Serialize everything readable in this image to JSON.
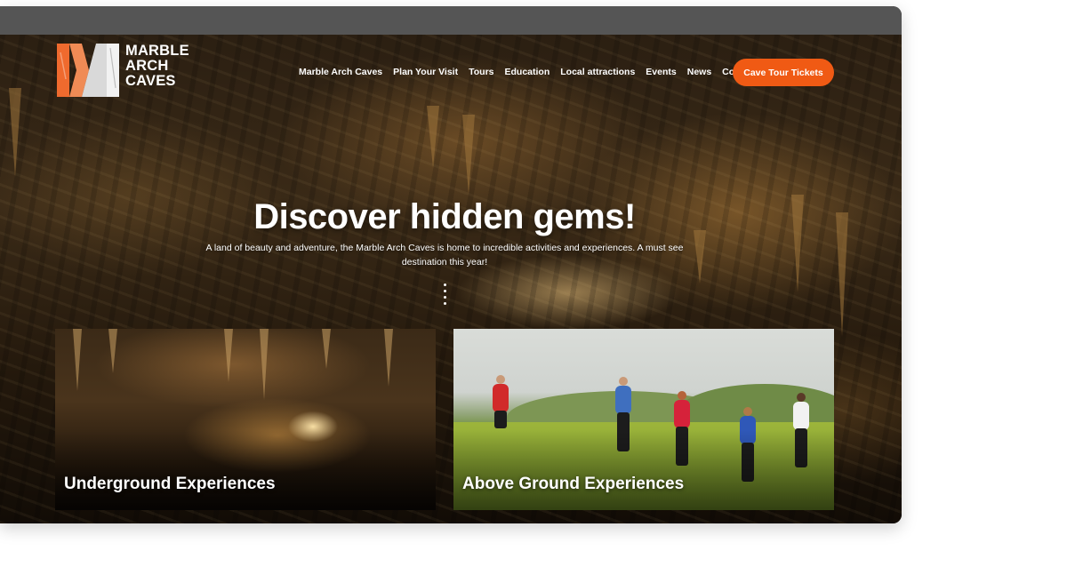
{
  "brand": {
    "name_line1": "MARBLE",
    "name_line2": "ARCH",
    "name_line3": "CAVES",
    "accent_color": "#f05a14"
  },
  "nav": {
    "items": [
      {
        "label": "Marble Arch Caves"
      },
      {
        "label": "Plan Your Visit"
      },
      {
        "label": "Tours"
      },
      {
        "label": "Education"
      },
      {
        "label": "Local attractions"
      },
      {
        "label": "Events"
      },
      {
        "label": "News"
      },
      {
        "label": "Contact"
      }
    ],
    "cta_label": "Cave Tour Tickets"
  },
  "hero": {
    "title": "Discover hidden gems!",
    "subtitle": "A land of beauty and adventure, the Marble Arch Caves is home to incredible activities and experiences. A must see destination this year!",
    "scroll_icon": "vertical-dots-icon"
  },
  "cards": [
    {
      "label": "Underground Experiences"
    },
    {
      "label": "Above Ground Experiences"
    }
  ]
}
